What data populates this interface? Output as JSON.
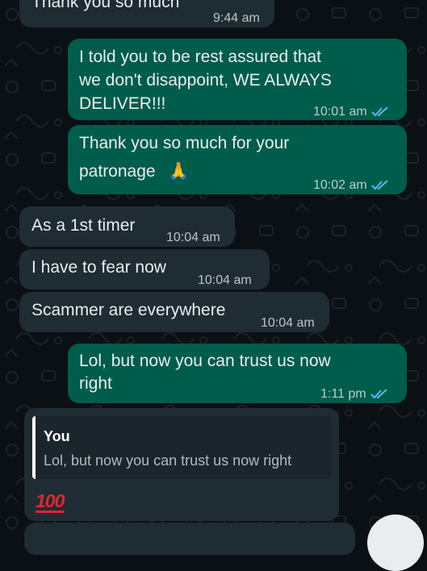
{
  "colors": {
    "background": "#0b1014",
    "incoming_bubble": "#1f2c33",
    "outgoing_bubble": "#005c4b",
    "read_ticks": "#53bdeb",
    "quote_bar": "#ffffff",
    "emoji_red": "#e0272c"
  },
  "messages": [
    {
      "direction": "incoming",
      "text": "Thank you so much",
      "time": "9:44 am"
    },
    {
      "direction": "outgoing",
      "lines": [
        "I told you to be rest assured that",
        "we don't disappoint, WE ALWAYS",
        "DELIVER!!!"
      ],
      "time": "10:01 am",
      "status": "read"
    },
    {
      "direction": "outgoing",
      "lines": [
        "Thank you so much for your",
        "patronage"
      ],
      "emoji": "🙏",
      "time": "10:02 am",
      "status": "read"
    },
    {
      "direction": "incoming",
      "text": "As a 1st timer",
      "time": "10:04 am"
    },
    {
      "direction": "incoming",
      "text": "I have to fear now",
      "time": "10:04 am"
    },
    {
      "direction": "incoming",
      "text": "Scammer are everywhere",
      "time": "10:04 am"
    },
    {
      "direction": "outgoing",
      "lines": [
        "Lol, but now you can trust us now",
        "right"
      ],
      "time": "1:11 pm",
      "status": "read"
    }
  ],
  "reply": {
    "quoted_author": "You",
    "quoted_text": "Lol, but now you can trust us now right",
    "emoji_text": "100"
  }
}
